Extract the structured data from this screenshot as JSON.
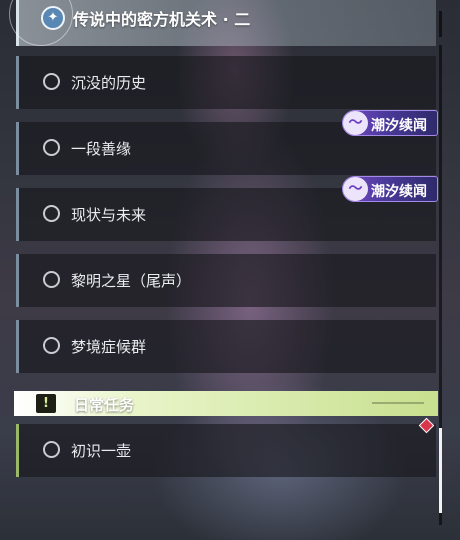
{
  "header": {
    "title": "传说中的密方机关术 · 二",
    "icon": "compass-star-icon"
  },
  "quests": [
    {
      "label": "沉没的历史"
    },
    {
      "label": "一段善缘"
    },
    {
      "label": "现状与未来"
    },
    {
      "label": "黎明之星（尾声）"
    },
    {
      "label": "梦境症候群"
    }
  ],
  "badges": [
    {
      "text": "潮汐续闻",
      "icon": "tide-swirl-icon"
    },
    {
      "text": "潮汐续闻",
      "icon": "tide-swirl-icon"
    }
  ],
  "daily_section": {
    "title": "日常任务",
    "icon": "exclamation-icon",
    "quests": [
      {
        "label": "初识一壶"
      }
    ]
  },
  "colors": {
    "header_accent": "#d8e4ea",
    "badge_purple": "#7848c8",
    "daily_green": "#c7e08e",
    "alert_red": "#d9354b"
  }
}
